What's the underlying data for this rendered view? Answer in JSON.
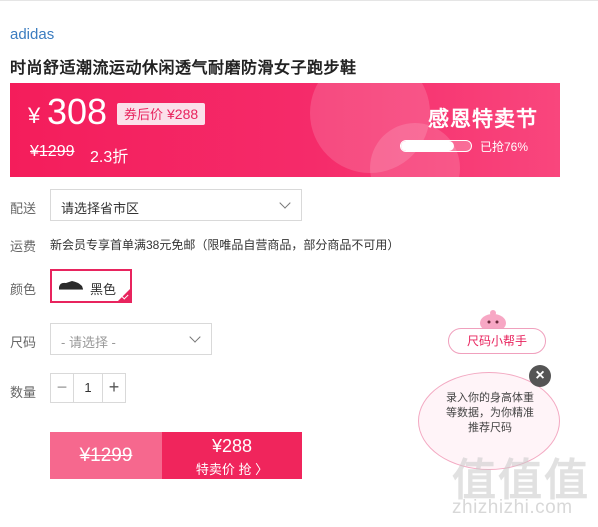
{
  "product": {
    "brand": "adidas",
    "title": "时尚舒适潮流运动休闲透气耐磨防滑女子跑步鞋"
  },
  "price_banner": {
    "currency": "¥",
    "price": "308",
    "coupon_label": "券后价",
    "coupon_price": "¥288",
    "original_price": "¥1299",
    "discount": "2.3折",
    "promo_title": "感恩特卖节",
    "sold_text": "已抢76%",
    "sold_percent": 76
  },
  "delivery": {
    "label": "配送",
    "select_value": "请选择省市区"
  },
  "shipping": {
    "label": "运费",
    "text": "新会员专享首单满38元免邮（限唯品自营商品，部分商品不可用）"
  },
  "color": {
    "label": "颜色",
    "selected": "黑色"
  },
  "size": {
    "label": "尺码",
    "placeholder": "- 请选择 -"
  },
  "quantity": {
    "label": "数量",
    "minus": "−",
    "value": "1",
    "plus": "+"
  },
  "buy": {
    "original_price": "¥1299",
    "sale_price": "¥288",
    "action": "特卖价 抢 〉"
  },
  "size_helper": {
    "pill_label": "尺码小帮手",
    "tip": "录入你的身高体重等数据，为你精准推荐尺码",
    "close": "×"
  },
  "watermark": {
    "glyphs": "值值值",
    "url": "zhizhizhi.com"
  },
  "colors": {
    "accent": "#f0255c",
    "banner": "#f41d5b",
    "brand_link": "#3a7cc0"
  }
}
